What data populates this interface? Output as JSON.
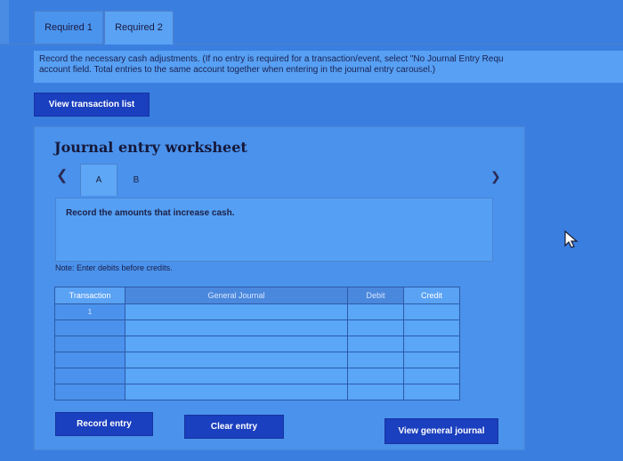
{
  "tabs": [
    {
      "label": "Required 1"
    },
    {
      "label": "Required 2"
    }
  ],
  "instruction": {
    "line1": "Record the necessary cash adjustments. (If no entry is required for a transaction/event, select \"No Journal Entry Requ",
    "line2": "account field. Total entries to the same account together when entering in the journal entry carousel.)"
  },
  "view_transaction_list": "View transaction list",
  "worksheet": {
    "title": "Journal entry worksheet",
    "prev_icon": "chevron-left-icon",
    "next_icon": "chevron-right-icon",
    "subtabs": [
      "A",
      "B"
    ],
    "description": "Record the amounts that increase cash.",
    "note": "Note: Enter debits before credits."
  },
  "table": {
    "headers": [
      "Transaction",
      "General Journal",
      "Debit",
      "Credit"
    ],
    "rows": [
      {
        "transaction": "1"
      },
      {
        "transaction": ""
      },
      {
        "transaction": ""
      },
      {
        "transaction": ""
      },
      {
        "transaction": ""
      },
      {
        "transaction": ""
      }
    ]
  },
  "buttons": {
    "record_entry": "Record entry",
    "clear_entry": "Clear entry",
    "view_general_journal": "View general journal"
  }
}
